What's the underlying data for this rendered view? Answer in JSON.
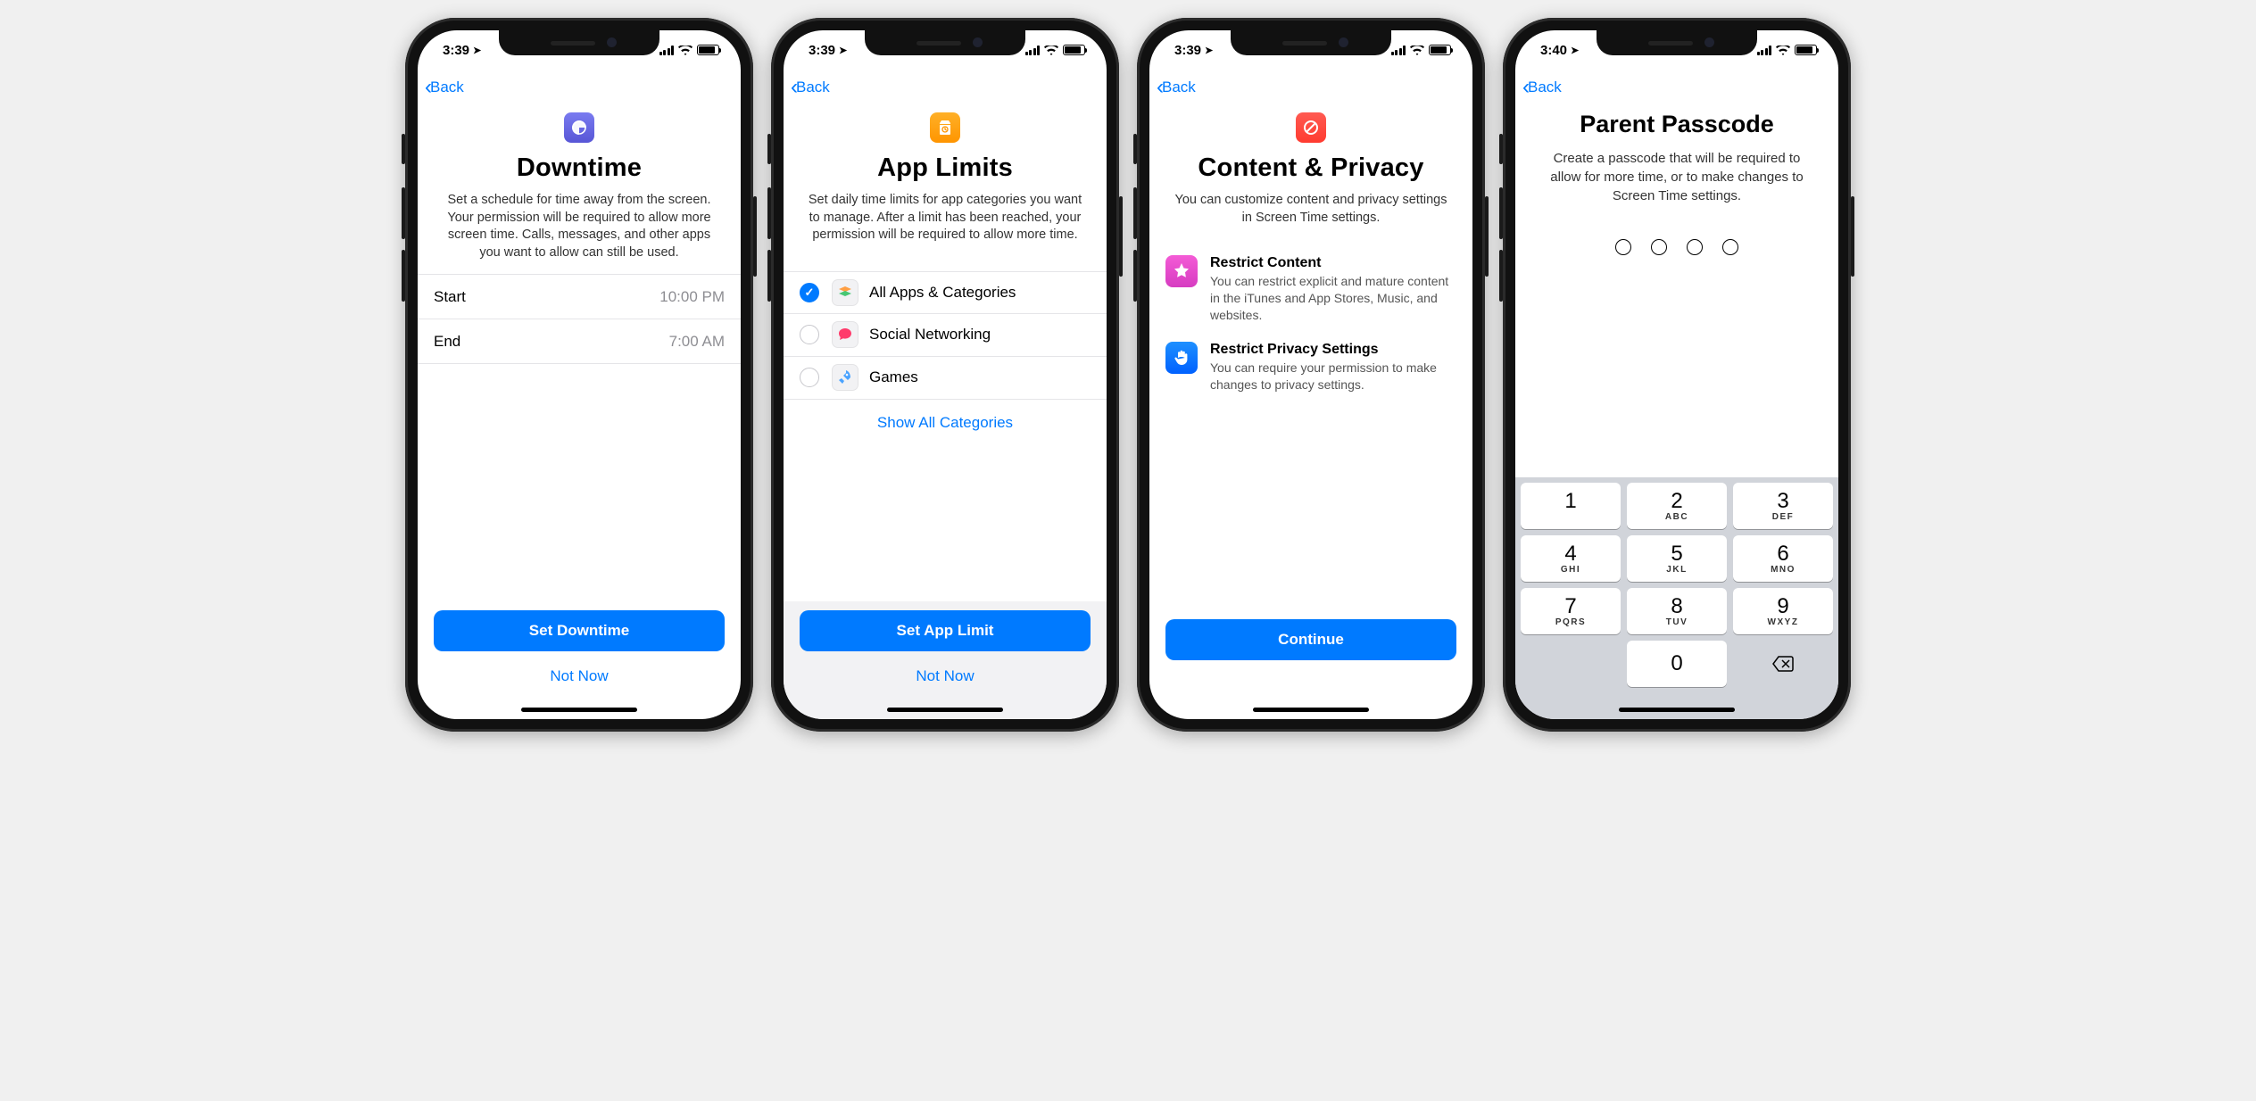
{
  "screen1": {
    "time": "3:39",
    "back": "Back",
    "title": "Downtime",
    "desc": "Set a schedule for time away from the screen. Your permission will be required to allow more screen time. Calls, messages, and other apps you want to allow can still be used.",
    "start_label": "Start",
    "start_value": "10:00 PM",
    "end_label": "End",
    "end_value": "7:00 AM",
    "primary": "Set Downtime",
    "secondary": "Not Now"
  },
  "screen2": {
    "time": "3:39",
    "back": "Back",
    "title": "App Limits",
    "desc": "Set daily time limits for app categories you want to manage. After a limit has been reached, your permission will be required to allow more time.",
    "categories": [
      {
        "label": "All Apps & Categories",
        "checked": true,
        "icon": "stack"
      },
      {
        "label": "Social Networking",
        "checked": false,
        "icon": "chat"
      },
      {
        "label": "Games",
        "checked": false,
        "icon": "rocket"
      }
    ],
    "show_all": "Show All Categories",
    "primary": "Set App Limit",
    "secondary": "Not Now"
  },
  "screen3": {
    "time": "3:39",
    "back": "Back",
    "title": "Content & Privacy",
    "desc": "You can customize content and privacy settings in Screen Time settings.",
    "features": [
      {
        "title": "Restrict Content",
        "desc": "You can restrict explicit and mature content in the iTunes and App Stores, Music, and websites.",
        "icon": "star"
      },
      {
        "title": "Restrict Privacy Settings",
        "desc": "You can require your permission to make changes to privacy settings.",
        "icon": "hand"
      }
    ],
    "primary": "Continue"
  },
  "screen4": {
    "time": "3:40",
    "back": "Back",
    "title": "Parent Passcode",
    "desc": "Create a passcode that will be required to allow for more time, or to make changes to Screen Time settings.",
    "keypad": [
      {
        "n": "1",
        "l": ""
      },
      {
        "n": "2",
        "l": "ABC"
      },
      {
        "n": "3",
        "l": "DEF"
      },
      {
        "n": "4",
        "l": "GHI"
      },
      {
        "n": "5",
        "l": "JKL"
      },
      {
        "n": "6",
        "l": "MNO"
      },
      {
        "n": "7",
        "l": "PQRS"
      },
      {
        "n": "8",
        "l": "TUV"
      },
      {
        "n": "9",
        "l": "WXYZ"
      },
      {
        "n": "",
        "l": ""
      },
      {
        "n": "0",
        "l": ""
      },
      {
        "n": "del",
        "l": ""
      }
    ]
  }
}
